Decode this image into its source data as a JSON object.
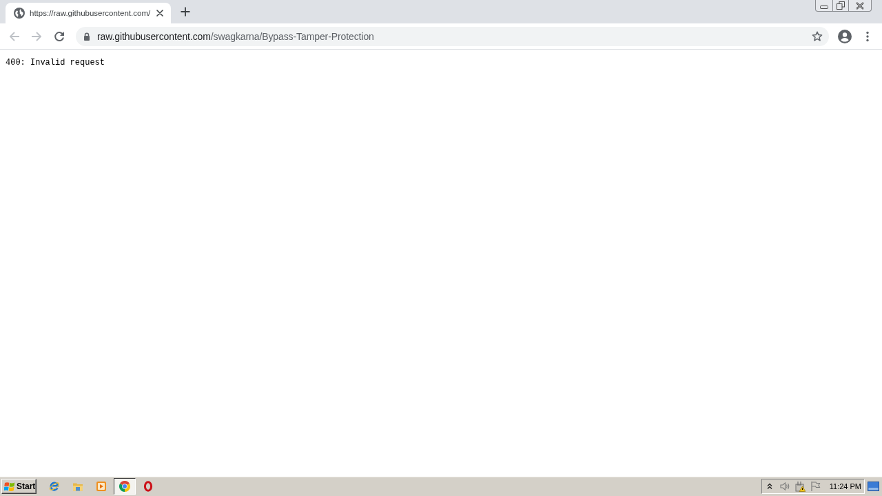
{
  "browser": {
    "tabs": [
      {
        "title": "https://raw.githubusercontent.com/",
        "selected": true
      }
    ],
    "navigation": {
      "back": {
        "disabled": true
      },
      "forward": {
        "disabled": true
      }
    },
    "address_bar": {
      "host": "raw.githubusercontent.com",
      "path": "/swagkarna/Bypass-Tamper-Protection"
    }
  },
  "page": {
    "text": "400: Invalid request"
  },
  "taskbar": {
    "start": "Start",
    "apps": [
      {
        "kind": "ie",
        "selected": false
      },
      {
        "kind": "explorer",
        "selected": false
      },
      {
        "kind": "media",
        "selected": false
      },
      {
        "kind": "chrome",
        "selected": true
      },
      {
        "kind": "opera",
        "selected": false
      }
    ],
    "clock": "11:24 PM"
  }
}
